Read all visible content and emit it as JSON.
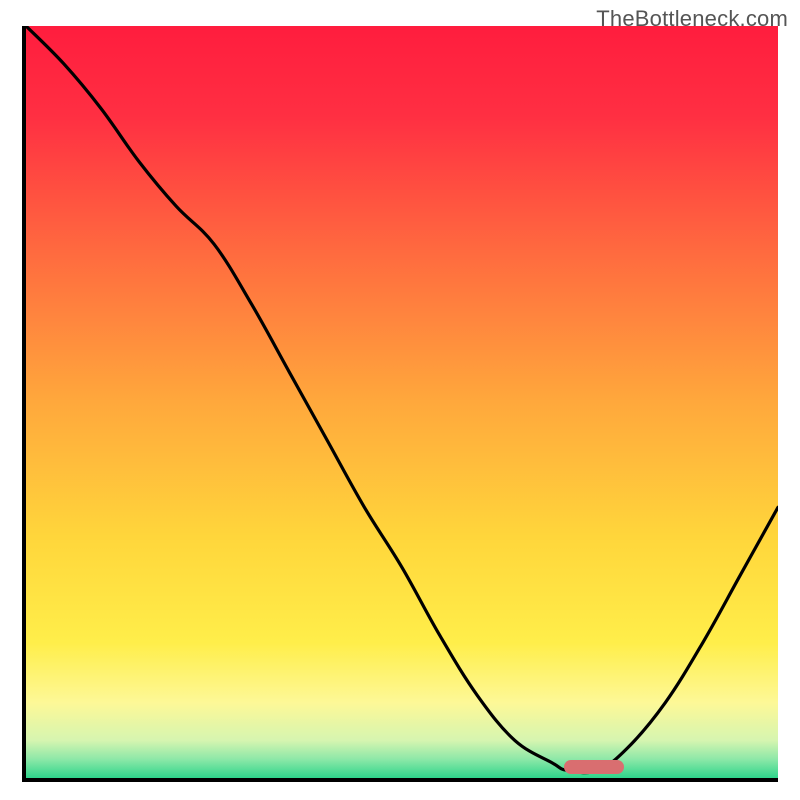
{
  "watermark": "TheBottleneck.com",
  "plot": {
    "inner_w": 752,
    "inner_h": 752
  },
  "gradient": {
    "stops": [
      {
        "offset": 0.0,
        "color": "#ff1d3e"
      },
      {
        "offset": 0.12,
        "color": "#ff2f42"
      },
      {
        "offset": 0.3,
        "color": "#ff6a3f"
      },
      {
        "offset": 0.5,
        "color": "#ffa83c"
      },
      {
        "offset": 0.68,
        "color": "#ffd63b"
      },
      {
        "offset": 0.82,
        "color": "#ffee4a"
      },
      {
        "offset": 0.9,
        "color": "#fdf897"
      },
      {
        "offset": 0.95,
        "color": "#d6f5b0"
      },
      {
        "offset": 0.975,
        "color": "#8de8a8"
      },
      {
        "offset": 1.0,
        "color": "#2fd58b"
      }
    ]
  },
  "marker": {
    "x_frac_left": 0.715,
    "x_frac_right": 0.795,
    "y_frac": 0.985,
    "color": "#d96e70"
  },
  "chart_data": {
    "type": "line",
    "title": "",
    "xlabel": "",
    "ylabel": "",
    "xlim": [
      0,
      100
    ],
    "ylim": [
      0,
      100
    ],
    "x": [
      0,
      5,
      10,
      15,
      20,
      25,
      30,
      35,
      40,
      45,
      50,
      55,
      60,
      65,
      70,
      72,
      76,
      80,
      85,
      90,
      95,
      100
    ],
    "y": [
      100,
      95,
      89,
      82,
      76,
      71,
      63,
      54,
      45,
      36,
      28,
      19,
      11,
      5,
      2,
      1,
      1,
      4,
      10,
      18,
      27,
      36
    ],
    "note": "Axis units are normalized 0–100 fractions of the plot area; values are read from the rendered curve position since the image has no numeric tick labels."
  }
}
